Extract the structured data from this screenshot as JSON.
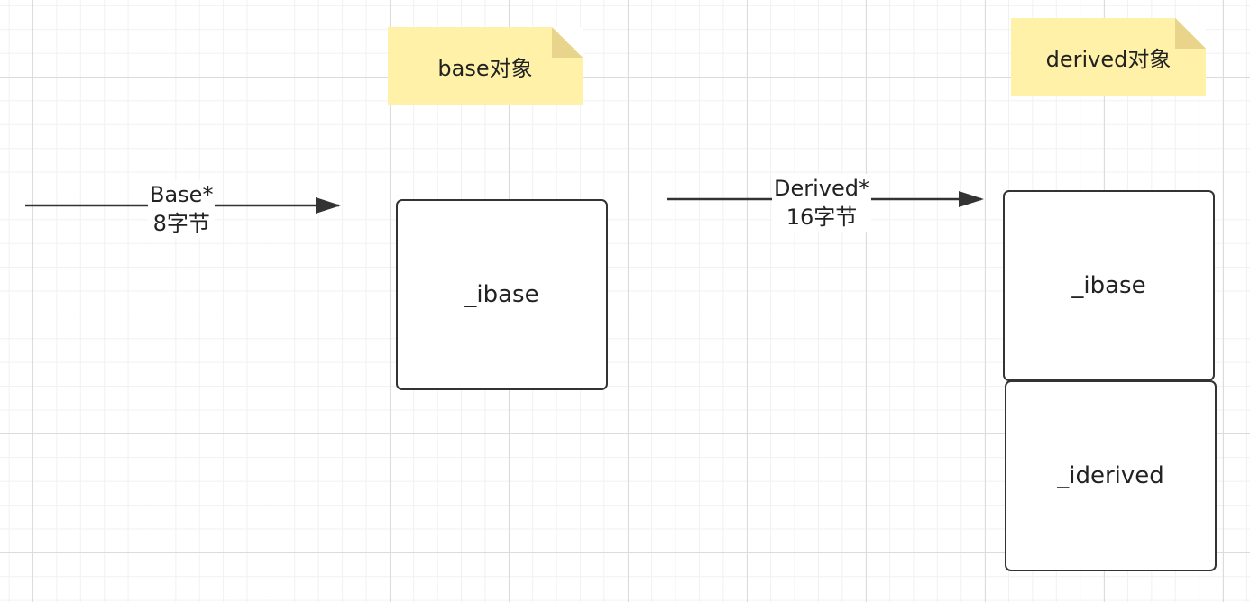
{
  "notes": {
    "base_object": "base对象",
    "derived_object": "derived对象"
  },
  "pointers": {
    "base_pointer": {
      "type": "Base*",
      "size": "8字节"
    },
    "derived_pointer": {
      "type": "Derived*",
      "size": "16字节"
    }
  },
  "boxes": {
    "base_ibase": "_ibase",
    "derived_ibase": "_ibase",
    "derived_iderived": "_iderived"
  },
  "colors": {
    "note_fill": "#fff2a8",
    "note_fold": "#e8d48a",
    "stroke": "#333333",
    "grid_major": "#dcdcdc",
    "grid_minor": "#f1f1f1"
  }
}
